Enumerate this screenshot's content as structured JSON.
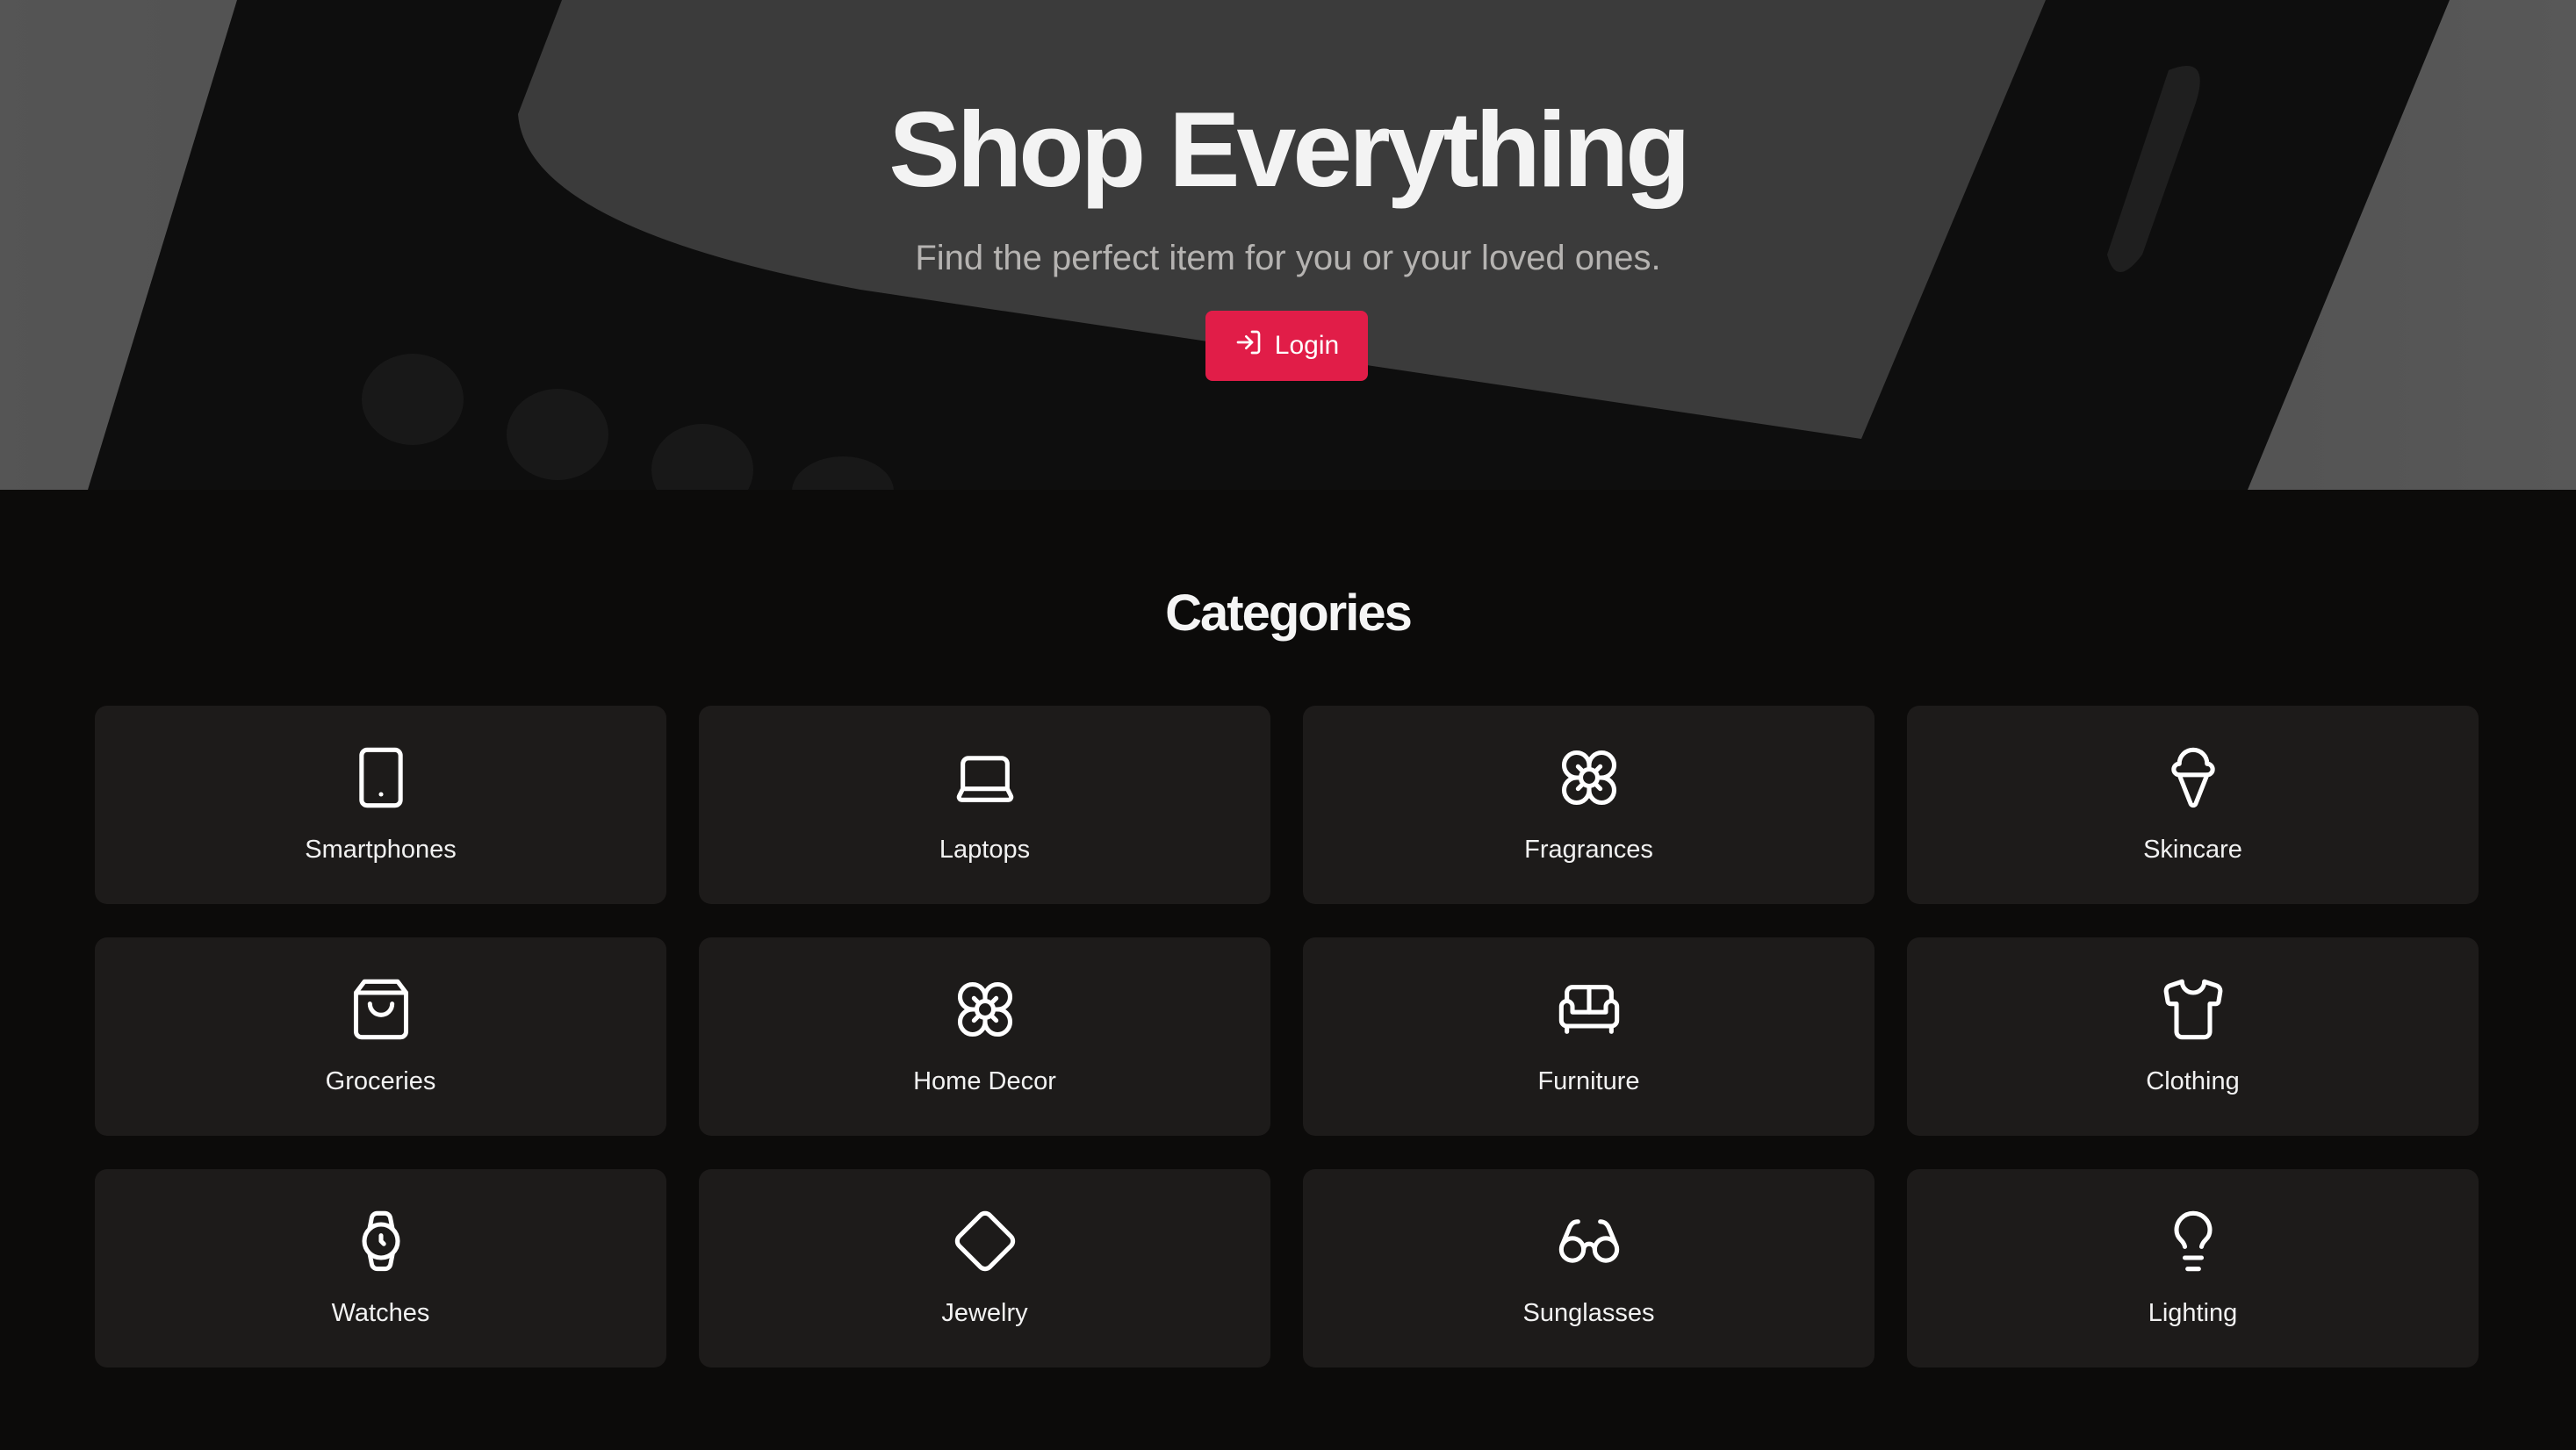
{
  "hero": {
    "title": "Shop Everything",
    "subtitle": "Find the perfect item for you or your loved ones.",
    "login_label": "Login",
    "accent_color": "#e11d48"
  },
  "categories": {
    "heading": "Categories",
    "items": [
      {
        "label": "Smartphones",
        "icon": "tablet-icon"
      },
      {
        "label": "Laptops",
        "icon": "laptop-icon"
      },
      {
        "label": "Fragrances",
        "icon": "flower-icon"
      },
      {
        "label": "Skincare",
        "icon": "ice-cream-icon"
      },
      {
        "label": "Groceries",
        "icon": "shopping-bag-icon"
      },
      {
        "label": "Home Decor",
        "icon": "flower-icon"
      },
      {
        "label": "Furniture",
        "icon": "sofa-icon"
      },
      {
        "label": "Clothing",
        "icon": "shirt-icon"
      },
      {
        "label": "Watches",
        "icon": "watch-icon"
      },
      {
        "label": "Jewelry",
        "icon": "diamond-icon"
      },
      {
        "label": "Sunglasses",
        "icon": "glasses-icon"
      },
      {
        "label": "Lighting",
        "icon": "lightbulb-icon"
      }
    ]
  }
}
